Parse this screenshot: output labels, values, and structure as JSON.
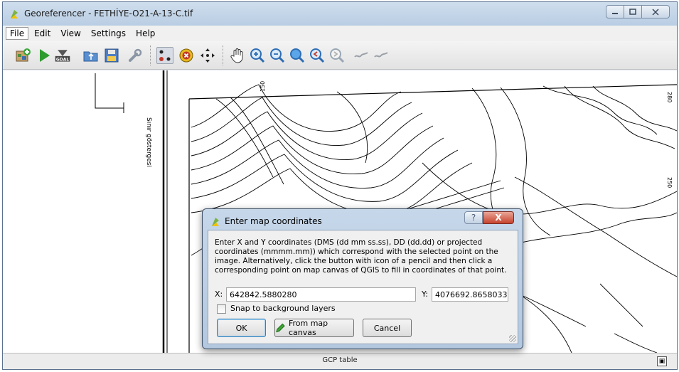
{
  "window": {
    "title": "Georeferencer - FETHİYE-O21-A-13-C.tif",
    "buttons": [
      "minimize",
      "maximize",
      "close"
    ]
  },
  "menu": [
    "File",
    "Edit",
    "View",
    "Settings",
    "Help"
  ],
  "toolbar": {
    "icons": [
      "add-raster-icon",
      "start-georeferencing-icon",
      "gdal-script-icon",
      "load-gcp-icon",
      "save-gcp-icon",
      "transformation-settings-icon",
      "add-point-icon",
      "delete-point-icon",
      "move-gcp-icon",
      "pan-icon",
      "zoom-in-icon",
      "zoom-out-icon",
      "zoom-to-layer-icon",
      "zoom-last-icon",
      "zoom-next-icon",
      "link-georeferencer-icon",
      "link-qgis-icon"
    ],
    "gdal_badge": "GDAL"
  },
  "map": {
    "margin_text": "Sınır göstergesi",
    "contour_labels": [
      "150",
      "280",
      "250"
    ]
  },
  "dialog": {
    "title": "Enter map coordinates",
    "help_label": "?",
    "close_label": "X",
    "description": "Enter X and Y coordinates (DMS (dd mm ss.ss), DD (dd.dd) or projected coordinates (mmmm.mm)) which correspond with the selected point on the image. Alternatively, click the button with icon of a pencil and then click a corresponding point on map canvas of QGIS to fill in coordinates of that point.",
    "x_label": "X:",
    "x_value": "642842.5880280",
    "y_label": "Y:",
    "y_value": "4076692.8658033",
    "snap_label": "Snap to background layers",
    "snap_checked": false,
    "ok_label": "OK",
    "from_canvas_label": "From map canvas",
    "cancel_label": "Cancel"
  },
  "status": {
    "gcp_table_label": "GCP table",
    "float_button": "▣"
  },
  "colors": {
    "title_bar": "#c4d6ea",
    "close_button": "#c7432e",
    "accent_green": "#2e9b2e"
  }
}
